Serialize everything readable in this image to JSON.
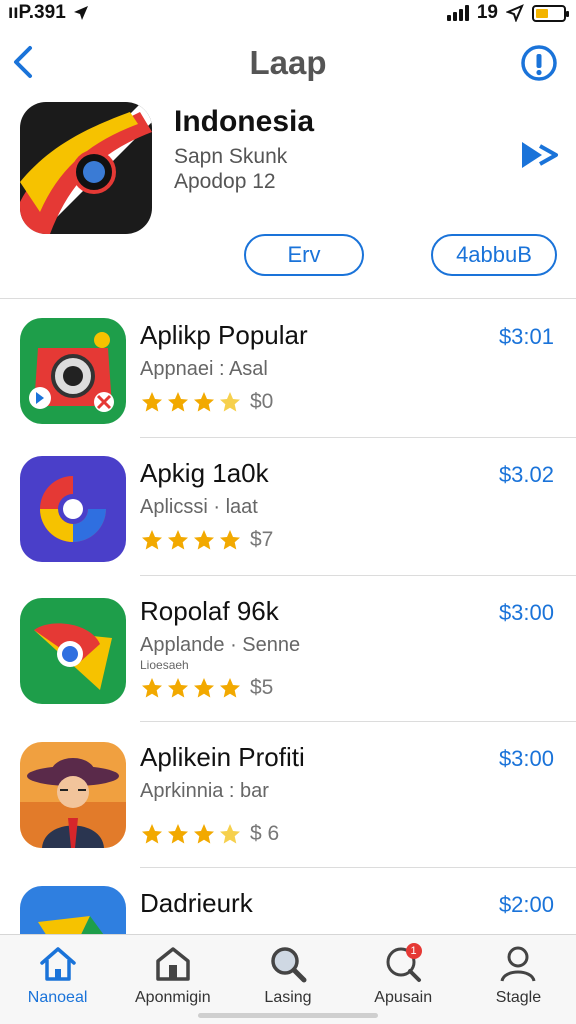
{
  "status_bar": {
    "left_text": "ııP.391",
    "right_text": "19"
  },
  "nav": {
    "title": "Laap",
    "back_icon": "chevron-left-icon",
    "info_icon": "info-icon"
  },
  "featured": {
    "name": "Indonesia",
    "subtitle_1": "Sapn Skunk",
    "subtitle_2": "Apodop 12",
    "button_left": "Erv",
    "button_right": "4abbuB"
  },
  "apps": [
    {
      "name": "Aplikp Popular",
      "subtitle": "Appnaei : Asal",
      "rating_text": "$0",
      "stars": 4,
      "price": "$3:01",
      "icon": "camera-app-icon"
    },
    {
      "name": "Apkig 1a0k",
      "subtitle": "Aplicssi · laat",
      "rating_text": "$7",
      "stars": 4,
      "price": "$3.02",
      "icon": "swirl-app-icon"
    },
    {
      "name": "Ropolaf 96k",
      "subtitle": "Applande · Senne",
      "subtitle_2": "Lioesaeh",
      "rating_text": "$5",
      "stars": 4,
      "price": "$3:00",
      "icon": "map-pin-app-icon"
    },
    {
      "name": "Aplikein Profiti",
      "subtitle": "Aprkinnia : bar",
      "rating_text": "$ 6",
      "stars": 4,
      "price": "$3:00",
      "icon": "portrait-app-icon"
    },
    {
      "name": "Dadrieurk",
      "subtitle": "",
      "rating_text": "",
      "stars": 0,
      "price": "$2:00",
      "icon": "triangle-app-icon"
    }
  ],
  "tabs": [
    {
      "label": "Nanoeal",
      "icon": "home-icon",
      "active": true
    },
    {
      "label": "Aponmigin",
      "icon": "store-icon",
      "active": false
    },
    {
      "label": "Lasing",
      "icon": "search-icon",
      "active": false
    },
    {
      "label": "Apusain",
      "icon": "chat-search-icon",
      "active": false,
      "badge": "1"
    },
    {
      "label": "Stagle",
      "icon": "profile-icon",
      "active": false
    }
  ],
  "colors": {
    "accent": "#1a73d9",
    "star": "#f2a900",
    "badge": "#e53935"
  }
}
